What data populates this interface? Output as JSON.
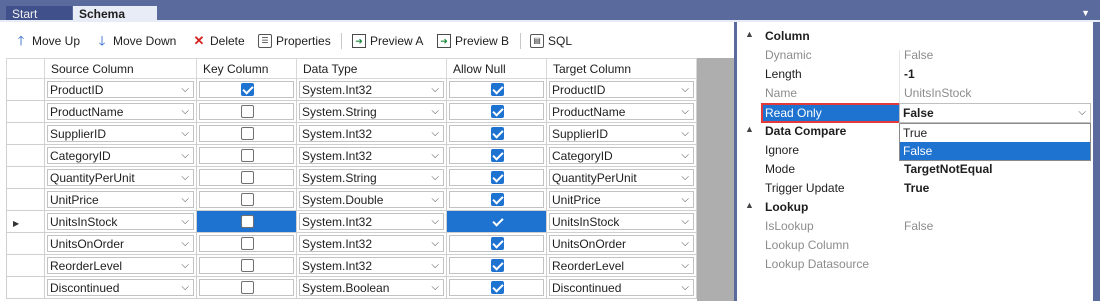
{
  "tabs": [
    {
      "label": "Start Page",
      "active": false
    },
    {
      "label": "Schema Map",
      "active": true
    }
  ],
  "toolbar": {
    "move_up": "Move Up",
    "move_down": "Move Down",
    "delete": "Delete",
    "properties": "Properties",
    "preview_a": "Preview A",
    "preview_b": "Preview B",
    "sql": "SQL"
  },
  "grid": {
    "columns": [
      "Source Column",
      "Key Column",
      "Data Type",
      "Allow Null",
      "Target Column"
    ],
    "rows": [
      {
        "source": "ProductID",
        "key": true,
        "type": "System.Int32",
        "allow_null": true,
        "target": "ProductID",
        "current": false
      },
      {
        "source": "ProductName",
        "key": false,
        "type": "System.String",
        "allow_null": true,
        "target": "ProductName",
        "current": false
      },
      {
        "source": "SupplierID",
        "key": false,
        "type": "System.Int32",
        "allow_null": true,
        "target": "SupplierID",
        "current": false
      },
      {
        "source": "CategoryID",
        "key": false,
        "type": "System.Int32",
        "allow_null": true,
        "target": "CategoryID",
        "current": false
      },
      {
        "source": "QuantityPerUnit",
        "key": false,
        "type": "System.String",
        "allow_null": true,
        "target": "QuantityPerUnit",
        "current": false
      },
      {
        "source": "UnitPrice",
        "key": false,
        "type": "System.Double",
        "allow_null": true,
        "target": "UnitPrice",
        "current": false
      },
      {
        "source": "UnitsInStock",
        "key": false,
        "type": "System.Int32",
        "allow_null": true,
        "target": "UnitsInStock",
        "current": true
      },
      {
        "source": "UnitsOnOrder",
        "key": false,
        "type": "System.Int32",
        "allow_null": true,
        "target": "UnitsOnOrder",
        "current": false
      },
      {
        "source": "ReorderLevel",
        "key": false,
        "type": "System.Int32",
        "allow_null": true,
        "target": "ReorderLevel",
        "current": false
      },
      {
        "source": "Discontinued",
        "key": false,
        "type": "System.Boolean",
        "allow_null": true,
        "target": "Discontinued",
        "current": false
      }
    ]
  },
  "properties": {
    "column_category": "Column",
    "dynamic_name": "Dynamic",
    "dynamic_value": "False",
    "length_name": "Length",
    "length_value": "-1",
    "name_name": "Name",
    "name_value": "UnitsInStock",
    "readonly_name": "Read Only",
    "readonly_value": "False",
    "readonly_options": [
      "True",
      "False"
    ],
    "compare_category": "Data Compare",
    "ignore_name": "Ignore",
    "mode_name": "Mode",
    "mode_value": "TargetNotEqual",
    "trigger_name": "Trigger Update",
    "trigger_value": "True",
    "lookup_category": "Lookup",
    "islookup_name": "IsLookup",
    "islookup_value": "False",
    "lookup_column_name": "Lookup Column",
    "lookup_datasource_name": "Lookup Datasource"
  },
  "icons": {
    "move_up": "arrow-up-icon",
    "move_down": "arrow-down-icon",
    "delete": "delete-x-icon",
    "properties": "properties-icon",
    "preview": "preview-icon",
    "sql": "sql-icon"
  },
  "colors": {
    "accent": "#1f73d0",
    "frame": "#5a6a9c",
    "highlight_border": "#e23a3a"
  }
}
